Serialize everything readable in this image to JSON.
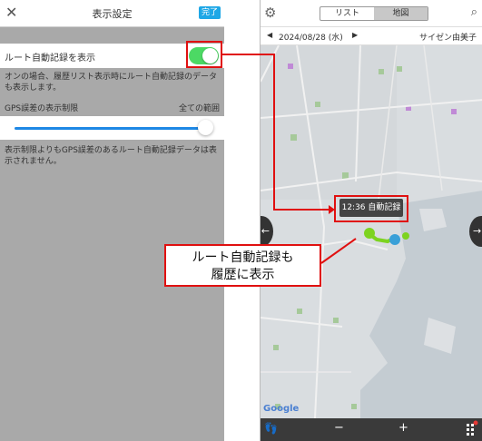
{
  "settings": {
    "title": "表示設定",
    "done_label": "完了",
    "route_toggle_label": "ルート自動記録を表示",
    "route_toggle_on": true,
    "route_description": "オンの場合、履歴リスト表示時にルート自動記録のデータも表示します。",
    "gps_label": "GPS誤差の表示制限",
    "gps_value": "全ての範囲",
    "gps_slider_level": 1.0,
    "gps_description": "表示制限よりもGPS誤差のあるルート自動記録データは表示されません。"
  },
  "map_screen": {
    "tabs": [
      {
        "label": "リスト",
        "active": false
      },
      {
        "label": "地図",
        "active": true
      }
    ],
    "date_label": "2024/08/28 (水)",
    "user_label": "サイゼン由美子",
    "tooltip_label": "12:36 自動記録",
    "map_attribution": "Google",
    "zoom_out_label": "−",
    "zoom_in_label": "+"
  },
  "annotation": {
    "callout_line1": "ルート自動記録も",
    "callout_line2": "履歴に表示"
  },
  "colors": {
    "toggle_on": "#4cd964",
    "accent_blue": "#1ea7e6",
    "annotation_red": "#e01010"
  }
}
